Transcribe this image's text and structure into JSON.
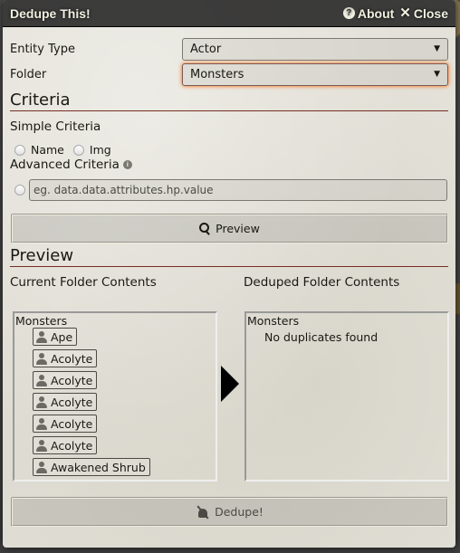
{
  "window": {
    "title": "Dedupe This!",
    "about_label": "About",
    "close_label": "Close"
  },
  "form": {
    "entity_type_label": "Entity Type",
    "entity_type_value": "Actor",
    "folder_label": "Folder",
    "folder_value": "Monsters"
  },
  "criteria": {
    "heading": "Criteria",
    "simple_heading": "Simple Criteria",
    "options": [
      {
        "label": "Name",
        "checked": false
      },
      {
        "label": "Img",
        "checked": false
      }
    ],
    "advanced_heading": "Advanced Criteria",
    "advanced_placeholder": "eg. data.data.attributes.hp.value",
    "advanced_value": ""
  },
  "preview": {
    "button_label": "Preview",
    "heading": "Preview",
    "current_heading": "Current Folder Contents",
    "deduped_heading": "Deduped Folder Contents",
    "current": {
      "folder": "Monsters",
      "items": [
        "Ape",
        "Acolyte",
        "Acolyte",
        "Acolyte",
        "Acolyte",
        "Acolyte",
        "Awakened Shrub"
      ]
    },
    "deduped": {
      "folder": "Monsters",
      "message": "No duplicates found"
    }
  },
  "actions": {
    "dedupe_label": "Dedupe!"
  }
}
